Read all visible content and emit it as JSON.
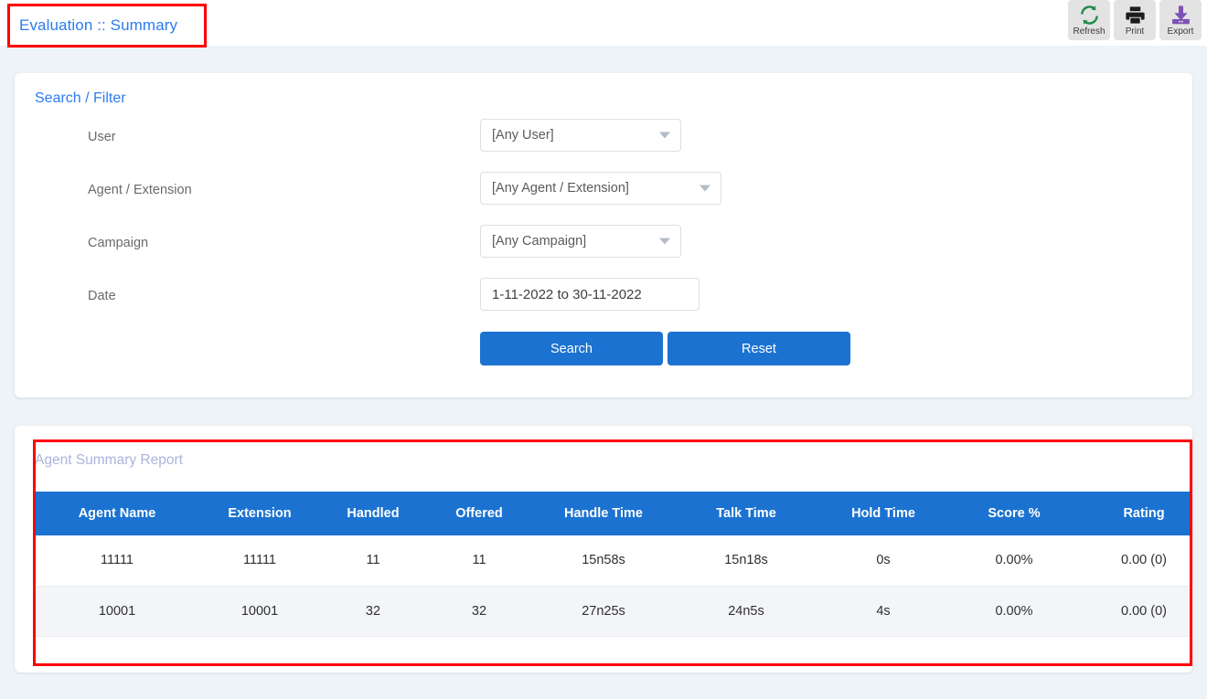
{
  "header": {
    "title": "Evaluation :: Summary",
    "toolbar": [
      {
        "label": "Refresh",
        "icon": "refresh-icon",
        "color": "#1f8a4c"
      },
      {
        "label": "Print",
        "icon": "print-icon",
        "color": "#1c1c1c"
      },
      {
        "label": "Export",
        "icon": "export-icon",
        "color": "#7b52b5"
      }
    ]
  },
  "filter": {
    "heading": "Search / Filter",
    "fields": [
      {
        "label": "User",
        "value": "[Any User]",
        "type": "select"
      },
      {
        "label": "Agent / Extension",
        "value": "[Any Agent / Extension]",
        "type": "select"
      },
      {
        "label": "Campaign",
        "value": "[Any Campaign]",
        "type": "select"
      },
      {
        "label": "Date",
        "value": "1-11-2022 to 30-11-2022",
        "type": "text",
        "placeholder": "Select date range"
      }
    ],
    "search_label": "Search",
    "reset_label": "Reset"
  },
  "report": {
    "heading": "Agent Summary Report",
    "columns": [
      "Agent Name",
      "Extension",
      "Handled",
      "Offered",
      "Handle Time",
      "Talk Time",
      "Hold Time",
      "Score %",
      "Rating"
    ],
    "rows": [
      {
        "agent_name": "11111",
        "extension": "11111",
        "handled": "11",
        "offered": "11",
        "handle_time": "15n58s",
        "talk_time": "15n18s",
        "hold_time": "0s",
        "score": "0.00%",
        "rating": "0.00 (0)"
      },
      {
        "agent_name": "10001",
        "extension": "10001",
        "handled": "32",
        "offered": "32",
        "handle_time": "27n25s",
        "talk_time": "24n5s",
        "hold_time": "4s",
        "score": "0.00%",
        "rating": "0.00 (0)"
      }
    ]
  },
  "colors": {
    "accent_blue": "#1b72d0",
    "title_blue": "#2b7cf0",
    "page_background": "#eef3f7",
    "annotation_red": "#ff0000",
    "report_heading": "#a9b4da"
  }
}
